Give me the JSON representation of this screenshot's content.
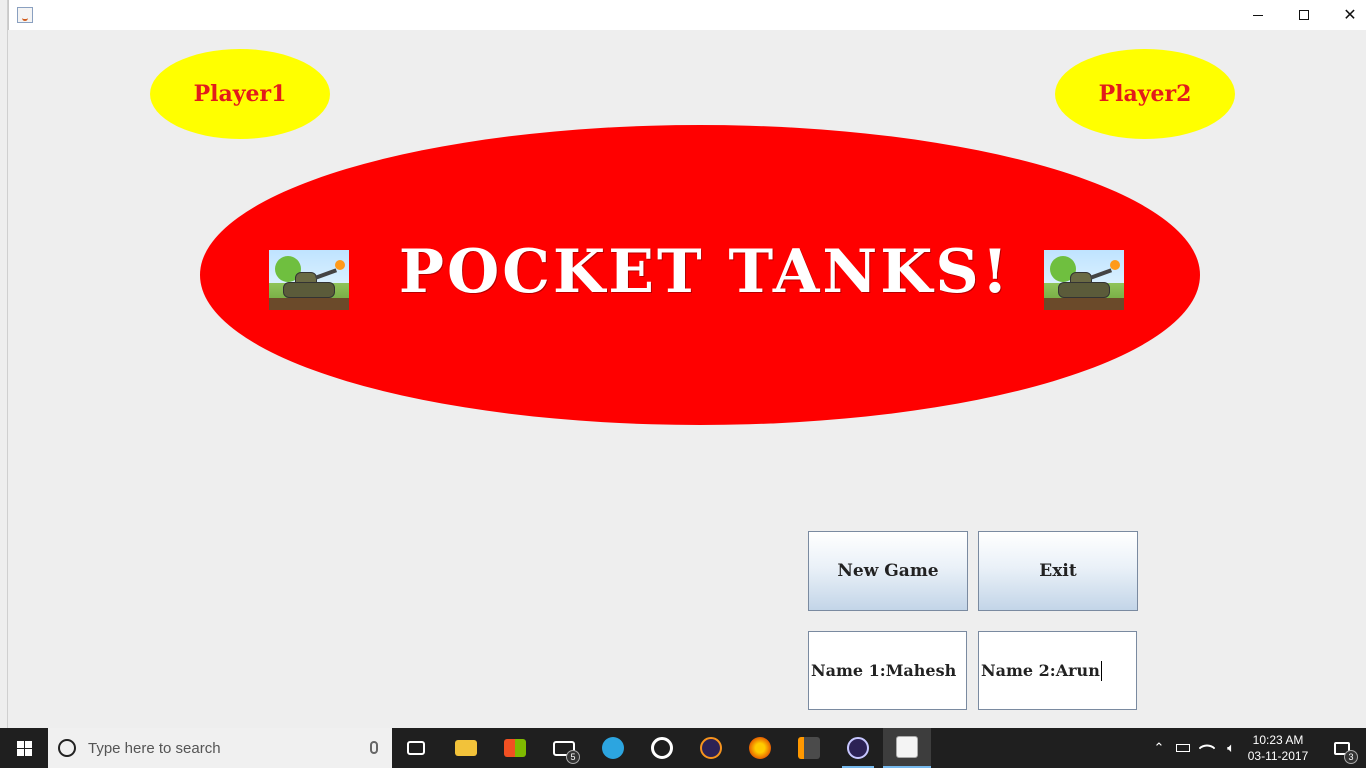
{
  "game": {
    "player1_label": "Player1",
    "player2_label": "Player2",
    "title": "POCKET TANKS!",
    "new_game_label": "New Game",
    "exit_label": "Exit",
    "name1_value": "Name 1:Mahesh",
    "name2_value": "Name 2:Arun"
  },
  "colors": {
    "background": "#eeeeee",
    "banner": "#ff0000",
    "player_oval": "#ffff00",
    "player_text": "#e21b1b",
    "title_text": "#ffffff"
  },
  "taskbar": {
    "search_placeholder": "Type here to search",
    "mail_badge": "5",
    "time": "10:23 AM",
    "date": "03-11-2017",
    "notification_badge": "3",
    "pinned": [
      "task-view-icon",
      "file-explorer-icon",
      "store-icon",
      "mail-icon",
      "telegram-icon",
      "chrome-like-icon",
      "eclipse-icon",
      "firefox-icon",
      "sublime-text-icon",
      "eclipse-icon",
      "java-icon"
    ]
  }
}
